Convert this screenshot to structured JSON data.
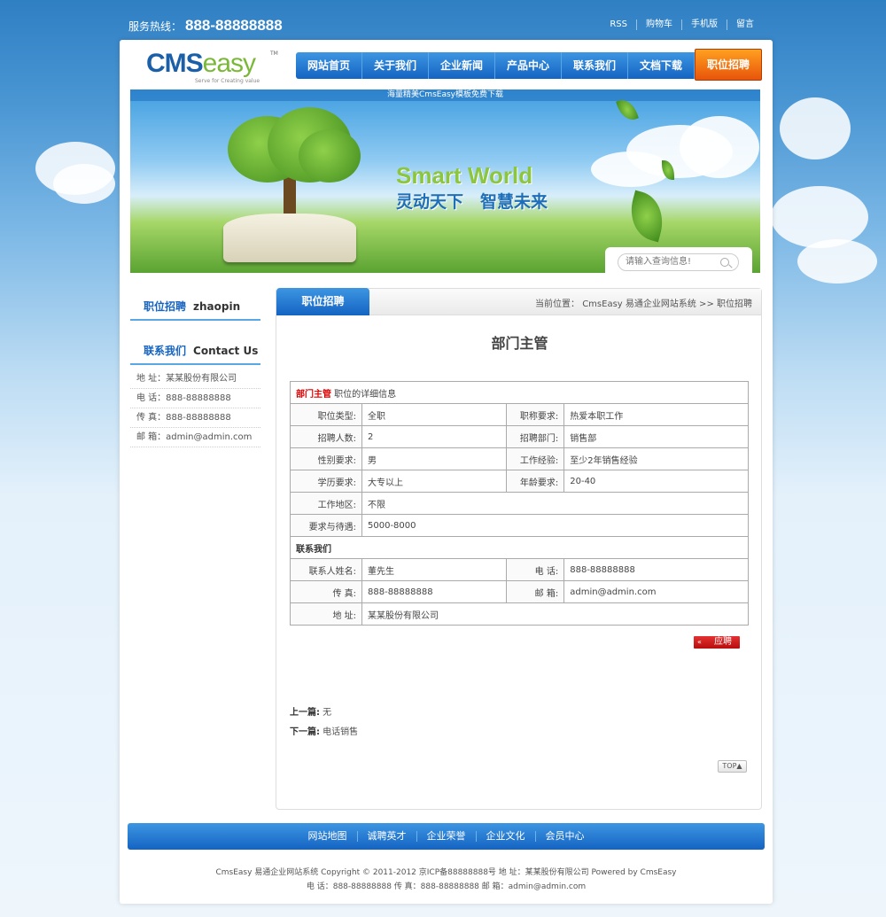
{
  "topbar": {
    "hotline_label": "服务热线：",
    "hotline_number": "888-88888888",
    "links": [
      "RSS",
      "购物车",
      "手机版",
      "留言"
    ]
  },
  "logo": {
    "text_a": "CMS",
    "text_b": "easy",
    "tm": "TM",
    "slogan": "Serve for Creating value"
  },
  "nav": [
    "网站首页",
    "关于我们",
    "企业新闻",
    "产品中心",
    "联系我们",
    "文档下载",
    "职位招聘"
  ],
  "banner": {
    "top_text": "海量精美CmsEasy模板免费下载",
    "headline_en": "Smart World",
    "headline_cn": "灵动天下　智慧未来",
    "search_placeholder": "请输入查询信息!"
  },
  "sidebar": {
    "section1": {
      "cn": "职位招聘",
      "en": "zhaopin"
    },
    "section2": {
      "cn": "联系我们",
      "en": "Contact Us"
    },
    "contacts": [
      "地 址：某某股份有限公司",
      "电 话：888-88888888",
      "传 真：888-88888888",
      "邮 箱：admin@admin.com"
    ]
  },
  "main": {
    "tab": "职位招聘",
    "crumb": "当前位置： CmsEasy 易通企业网站系统 >> 职位招聘",
    "title": "部门主管",
    "table_head_name": "部门主管",
    "table_head_rest": " 职位的详细信息",
    "rows": {
      "type_l": "职位类型:",
      "type_v": "全职",
      "req_l": "职称要求:",
      "req_v": "热爱本职工作",
      "num_l": "招聘人数:",
      "num_v": "2",
      "dept_l": "招聘部门:",
      "dept_v": "销售部",
      "sex_l": "性别要求:",
      "sex_v": "男",
      "exp_l": "工作经验:",
      "exp_v": "至少2年销售经验",
      "edu_l": "学历要求:",
      "edu_v": "大专以上",
      "age_l": "年龄要求:",
      "age_v": "20-40",
      "area_l": "工作地区:",
      "area_v": "不限",
      "pay_l": "要求与待遇:",
      "pay_v": "5000-8000",
      "contact_section": "联系我们",
      "cname_l": "联系人姓名:",
      "cname_v": "董先生",
      "tel_l": "电 话:",
      "tel_v": "888-88888888",
      "fax_l": "传 真:",
      "fax_v": "888-88888888",
      "mail_l": "邮 箱:",
      "mail_v": "admin@admin.com",
      "addr_l": "地 址:",
      "addr_v": "某某股份有限公司"
    },
    "apply_arrow": "«",
    "apply_label": "应聘",
    "prev_label": "上一篇:",
    "prev_value": " 无",
    "next_label": "下一篇:",
    "next_value": " 电话销售",
    "top_label": "TOP▲"
  },
  "footer": {
    "nav": [
      "网站地图",
      "诚聘英才",
      "企业荣誉",
      "企业文化",
      "会员中心"
    ],
    "line1": "CmsEasy 易通企业网站系统  Copyright © 2011-2012  京ICP备88888888号  地 址：某某股份有限公司   Powered by CmsEasy",
    "line2": "电 话：888-88888888  传 真：888-88888888  邮 箱：admin@admin.com"
  }
}
